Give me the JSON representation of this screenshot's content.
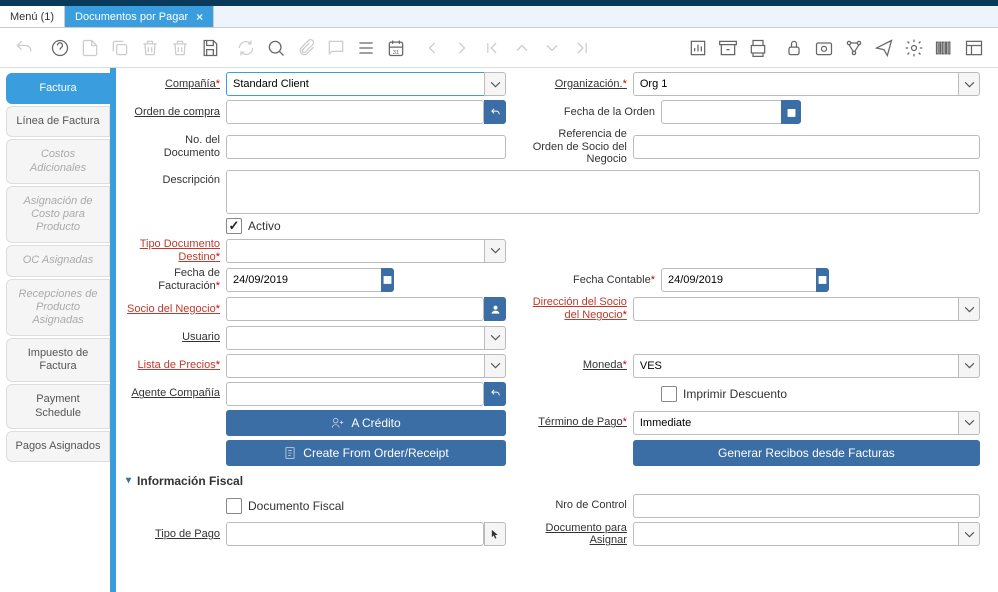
{
  "tabs": {
    "menu": "Menú (1)",
    "active": "Documentos por Pagar"
  },
  "sidetabs": {
    "factura": "Factura",
    "linea": "Línea de Factura",
    "costos": "Costos Adicionales",
    "asigcosto": "Asignación de Costo para Producto",
    "oc": "OC Asignadas",
    "recep": "Recepciones de Producto Asignadas",
    "impuesto": "Impuesto de Factura",
    "payment": "Payment Schedule",
    "pagos": "Pagos Asignados"
  },
  "labels": {
    "compania": "Compañía",
    "organizacion": "Organización.",
    "ordencompra": "Orden de compra",
    "fechaorden": "Fecha de la Orden",
    "nodoc": "No. del Documento",
    "refsocio": "Referencia de Orden de Socio del Negocio",
    "descripcion": "Descripción",
    "activo": "Activo",
    "tipodoc": "Tipo Documento Destino",
    "fechafact": "Fecha de Facturación",
    "fechacont": "Fecha Contable",
    "socio": "Socio del Negocio",
    "dirsocio": "Dirección del Socio del Negocio",
    "usuario": "Usuario",
    "listaprecios": "Lista de Precios",
    "moneda": "Moneda",
    "agente": "Agente Compañía",
    "imprimir": "Imprimir Descuento",
    "termino": "Término de Pago",
    "acredito": "A Crédito",
    "createfrom": "Create From Order/Receipt",
    "generar": "Generar Recibos desde Facturas",
    "infofiscal": "Información Fiscal",
    "docfiscal": "Documento Fiscal",
    "nrocontrol": "Nro de Control",
    "tipopago": "Tipo de Pago",
    "docasignar": "Documento para Asignar"
  },
  "values": {
    "compania": "Standard Client",
    "organizacion": "Org 1",
    "fechafact": "24/09/2019",
    "fechacont": "24/09/2019",
    "moneda": "VES",
    "termino": "Immediate"
  }
}
